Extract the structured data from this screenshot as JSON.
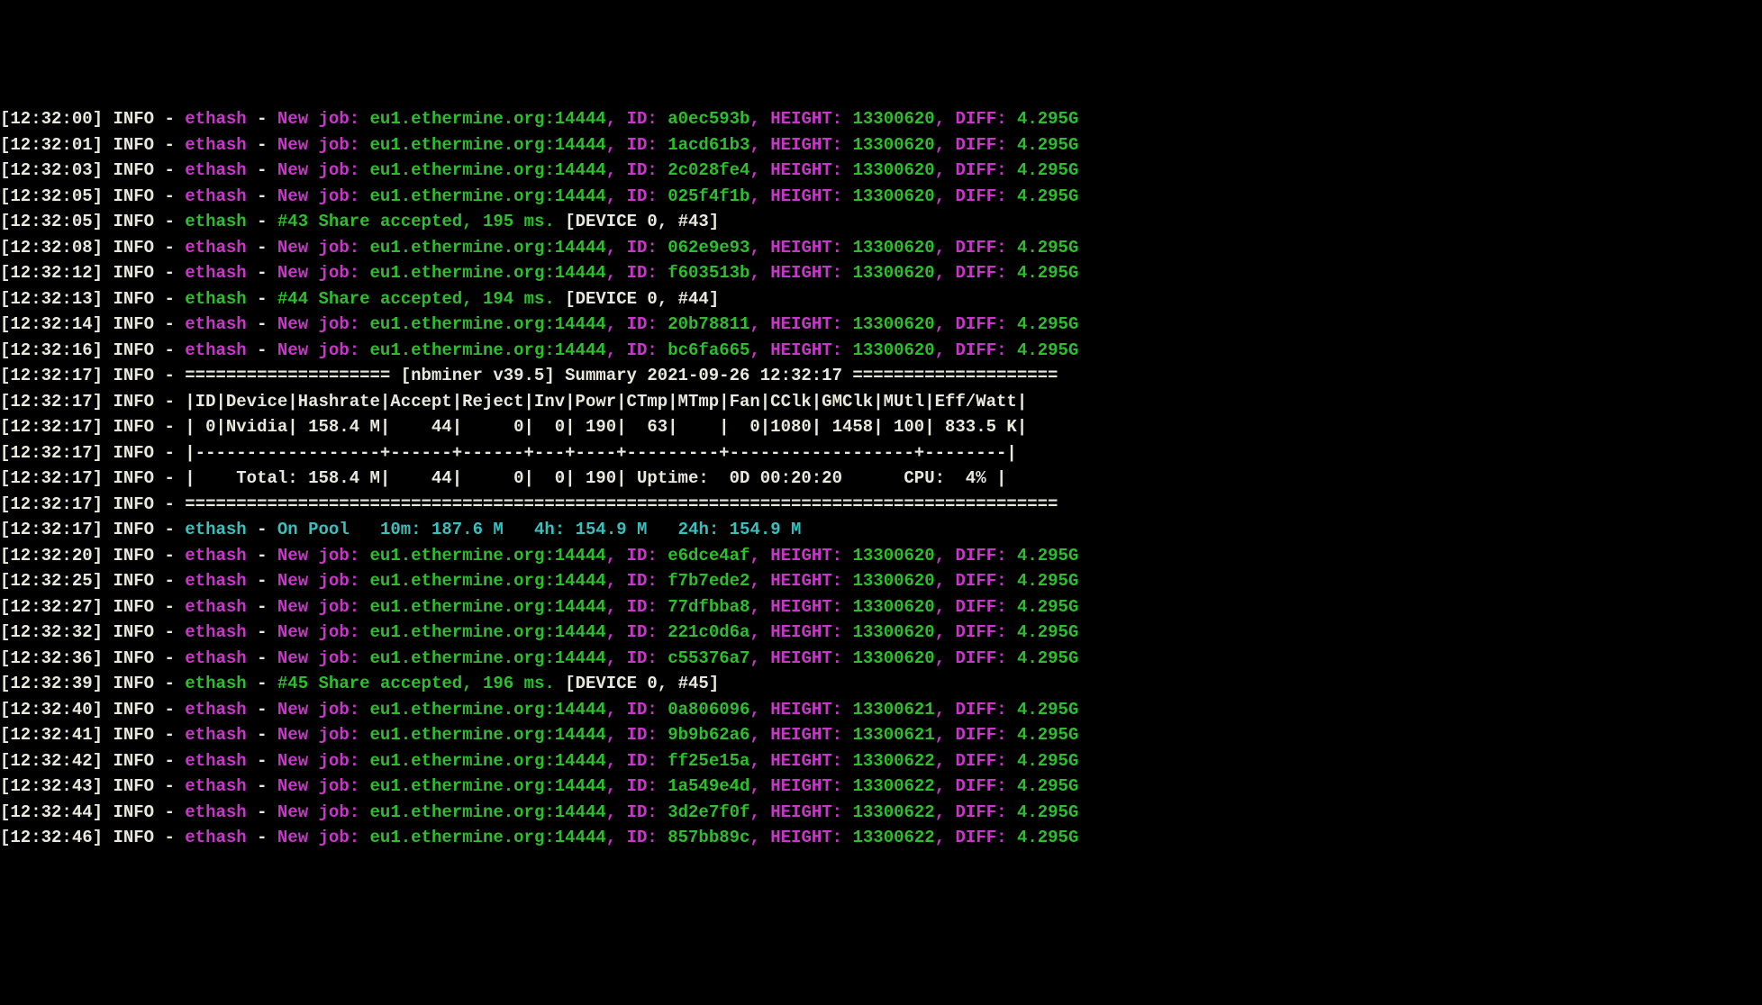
{
  "pool": "eu1.ethermine.org:14444",
  "lines": [
    {
      "ts": "12:32:00",
      "type": "job",
      "id": "a0ec593b",
      "height": "13300620",
      "diff": "4.295G"
    },
    {
      "ts": "12:32:01",
      "type": "job",
      "id": "1acd61b3",
      "height": "13300620",
      "diff": "4.295G"
    },
    {
      "ts": "12:32:03",
      "type": "job",
      "id": "2c028fe4",
      "height": "13300620",
      "diff": "4.295G"
    },
    {
      "ts": "12:32:05",
      "type": "job",
      "id": "025f4f1b",
      "height": "13300620",
      "diff": "4.295G"
    },
    {
      "ts": "12:32:05",
      "type": "share",
      "n": "#43",
      "ms": "195 ms.",
      "dev": "[DEVICE 0, #43]"
    },
    {
      "ts": "12:32:08",
      "type": "job",
      "id": "062e9e93",
      "height": "13300620",
      "diff": "4.295G"
    },
    {
      "ts": "12:32:12",
      "type": "job",
      "id": "f603513b",
      "height": "13300620",
      "diff": "4.295G"
    },
    {
      "ts": "12:32:13",
      "type": "share",
      "n": "#44",
      "ms": "194 ms.",
      "dev": "[DEVICE 0, #44]"
    },
    {
      "ts": "12:32:14",
      "type": "job",
      "id": "20b78811",
      "height": "13300620",
      "diff": "4.295G"
    },
    {
      "ts": "12:32:16",
      "type": "job",
      "id": "bc6fa665",
      "height": "13300620",
      "diff": "4.295G"
    },
    {
      "ts": "12:32:17",
      "type": "raw",
      "text": "==================== [nbminer v39.5] Summary 2021-09-26 12:32:17 ===================="
    },
    {
      "ts": "12:32:17",
      "type": "raw",
      "text": "|ID|Device|Hashrate|Accept|Reject|Inv|Powr|CTmp|MTmp|Fan|CClk|GMClk|MUtl|Eff/Watt|"
    },
    {
      "ts": "12:32:17",
      "type": "raw",
      "text": "| 0|Nvidia| 158.4 M|    44|     0|  0| 190|  63|    |  0|1080| 1458| 100| 833.5 K|"
    },
    {
      "ts": "12:32:17",
      "type": "raw",
      "text": "|------------------+------+------+---+----+---------+------------------+--------|"
    },
    {
      "ts": "12:32:17",
      "type": "raw",
      "text": "|    Total: 158.4 M|    44|     0|  0| 190| Uptime:  0D 00:20:20      CPU:  4% |"
    },
    {
      "ts": "12:32:17",
      "type": "raw",
      "text": "====================================================================================="
    },
    {
      "ts": "12:32:17",
      "type": "pool",
      "ten": "10m: 187.6 M",
      "four": "4h: 154.9 M",
      "day": "24h: 154.9 M"
    },
    {
      "ts": "12:32:20",
      "type": "job",
      "id": "e6dce4af",
      "height": "13300620",
      "diff": "4.295G"
    },
    {
      "ts": "12:32:25",
      "type": "job",
      "id": "f7b7ede2",
      "height": "13300620",
      "diff": "4.295G"
    },
    {
      "ts": "12:32:27",
      "type": "job",
      "id": "77dfbba8",
      "height": "13300620",
      "diff": "4.295G"
    },
    {
      "ts": "12:32:32",
      "type": "job",
      "id": "221c0d6a",
      "height": "13300620",
      "diff": "4.295G"
    },
    {
      "ts": "12:32:36",
      "type": "job",
      "id": "c55376a7",
      "height": "13300620",
      "diff": "4.295G"
    },
    {
      "ts": "12:32:39",
      "type": "share",
      "n": "#45",
      "ms": "196 ms.",
      "dev": "[DEVICE 0, #45]"
    },
    {
      "ts": "12:32:40",
      "type": "job",
      "id": "0a806096",
      "height": "13300621",
      "diff": "4.295G"
    },
    {
      "ts": "12:32:41",
      "type": "job",
      "id": "9b9b62a6",
      "height": "13300621",
      "diff": "4.295G"
    },
    {
      "ts": "12:32:42",
      "type": "job",
      "id": "ff25e15a",
      "height": "13300622",
      "diff": "4.295G"
    },
    {
      "ts": "12:32:43",
      "type": "job",
      "id": "1a549e4d",
      "height": "13300622",
      "diff": "4.295G"
    },
    {
      "ts": "12:32:44",
      "type": "job",
      "id": "3d2e7f0f",
      "height": "13300622",
      "diff": "4.295G"
    },
    {
      "ts": "12:32:46",
      "type": "job",
      "id": "857bb89c",
      "height": "13300622",
      "diff": "4.295G"
    }
  ],
  "labels": {
    "info": "INFO",
    "algo": "ethash",
    "newjob": "New job:",
    "idlbl": "ID:",
    "heightlbl": "HEIGHT:",
    "difflbl": "DIFF:",
    "shareacc": "Share accepted,",
    "onpool": "On Pool"
  }
}
